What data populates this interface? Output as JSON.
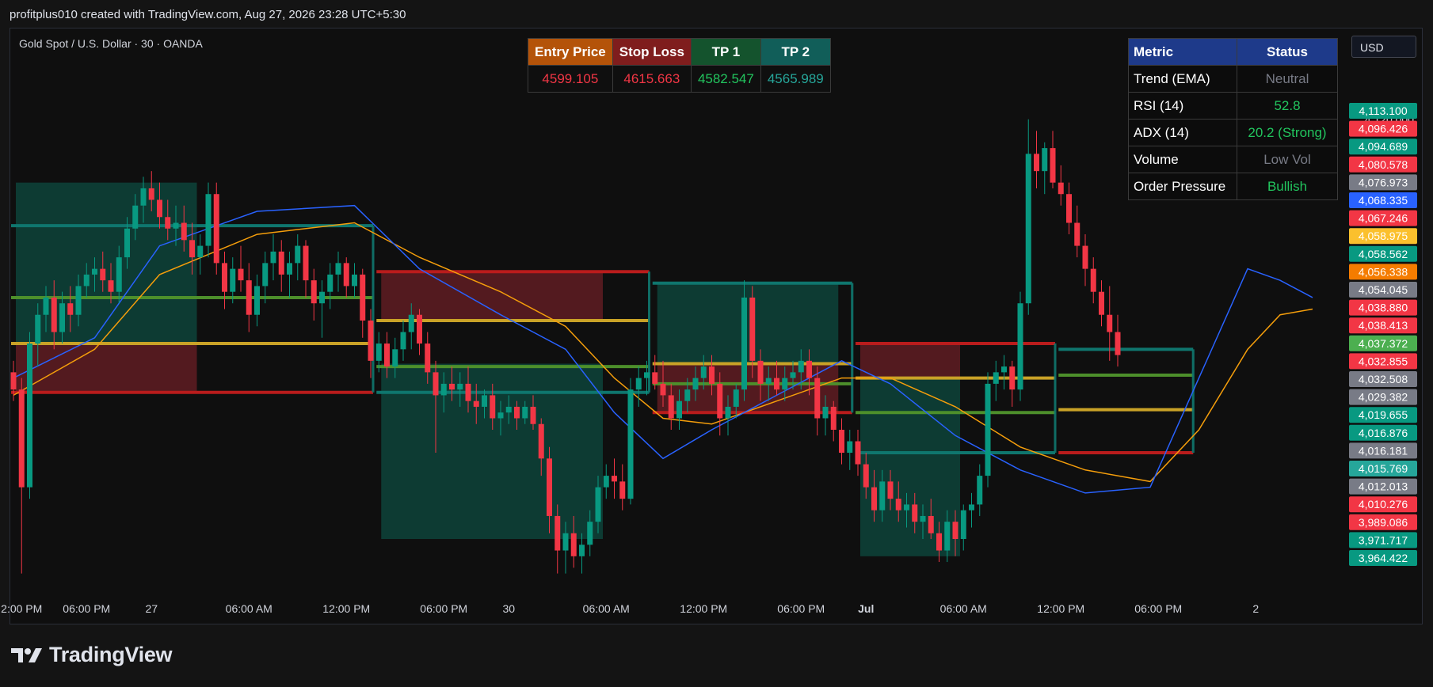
{
  "header": {
    "created_by": "profitplus010 created with TradingView.com, Aug 27, 2026 23:28 UTC+5:30"
  },
  "symbol": {
    "label": "Gold Spot / U.S. Dollar · 30 · OANDA"
  },
  "currency_button": {
    "label": "USD"
  },
  "brand": {
    "name": "TradingView"
  },
  "trade_table": {
    "headers": [
      {
        "label": "Entry Price",
        "bg": "#b45309"
      },
      {
        "label": "Stop Loss",
        "bg": "#7f1d1d"
      },
      {
        "label": "TP 1",
        "bg": "#14532d"
      },
      {
        "label": "TP 2",
        "bg": "#115e59"
      }
    ],
    "values": [
      {
        "value": "4599.105",
        "color": "#f23645"
      },
      {
        "value": "4615.663",
        "color": "#f23645"
      },
      {
        "value": "4582.547",
        "color": "#22c55e"
      },
      {
        "value": "4565.989",
        "color": "#26a69a"
      }
    ]
  },
  "status_table": {
    "headers": {
      "metric": "Metric",
      "status": "Status"
    },
    "rows": [
      {
        "metric": "Trend (EMA)",
        "status": "Neutral",
        "color": "#787b86"
      },
      {
        "metric": "RSI (14)",
        "status": "52.8",
        "color": "#22c55e"
      },
      {
        "metric": "ADX (14)",
        "status": "20.2 (Strong)",
        "color": "#22c55e"
      },
      {
        "metric": "Volume",
        "status": "Low Vol",
        "color": "#787b86"
      },
      {
        "metric": "Order Pressure",
        "status": "Bullish",
        "color": "#22c55e"
      }
    ]
  },
  "chart_data": {
    "type": "candlestick",
    "timeframe": "30",
    "title": "Gold Spot / U.S. Dollar · 30 · OANDA",
    "ylim": [
      3955,
      4145
    ],
    "x_ticks": [
      {
        "label": "2:00 PM",
        "bar": 1
      },
      {
        "label": "06:00 PM",
        "bar": 9
      },
      {
        "label": "27",
        "bar": 17
      },
      {
        "label": "06:00 AM",
        "bar": 29
      },
      {
        "label": "12:00 PM",
        "bar": 41
      },
      {
        "label": "06:00 PM",
        "bar": 53
      },
      {
        "label": "30",
        "bar": 61
      },
      {
        "label": "06:00 AM",
        "bar": 73
      },
      {
        "label": "12:00 PM",
        "bar": 85
      },
      {
        "label": "06:00 PM",
        "bar": 97
      },
      {
        "label": "Jul",
        "bar": 105,
        "bold": true
      },
      {
        "label": "06:00 AM",
        "bar": 117
      },
      {
        "label": "12:00 PM",
        "bar": 129
      },
      {
        "label": "06:00 PM",
        "bar": 141
      },
      {
        "label": "2",
        "bar": 153
      }
    ],
    "price_axis": {
      "tick_label": "4,120.000",
      "tick_value": 4120
    },
    "price_labels": [
      {
        "value": "4,113.100",
        "color": "#089981"
      },
      {
        "value": "4,096.426",
        "color": "#f23645"
      },
      {
        "value": "4,094.689",
        "color": "#089981"
      },
      {
        "value": "4,080.578",
        "color": "#f23645"
      },
      {
        "value": "4,076.973",
        "color": "#787b86"
      },
      {
        "value": "4,068.335",
        "color": "#2962ff"
      },
      {
        "value": "4,067.246",
        "color": "#f23645"
      },
      {
        "value": "4,058.975",
        "color": "#fbc02d"
      },
      {
        "value": "4,058.562",
        "color": "#089981"
      },
      {
        "value": "4,056.338",
        "color": "#f57c00"
      },
      {
        "value": "4,054.045",
        "color": "#787b86"
      },
      {
        "value": "4,038.880",
        "color": "#f23645"
      },
      {
        "value": "4,038.413",
        "color": "#f23645"
      },
      {
        "value": "4,037.372",
        "color": "#4caf50"
      },
      {
        "value": "4,032.855",
        "color": "#f23645"
      },
      {
        "value": "4,032.508",
        "color": "#787b86"
      },
      {
        "value": "4,029.382",
        "color": "#787b86"
      },
      {
        "value": "4,019.655",
        "color": "#089981"
      },
      {
        "value": "4,016.876",
        "color": "#089981"
      },
      {
        "value": "4,016.181",
        "color": "#787b86"
      },
      {
        "value": "4,015.769",
        "color": "#26a69a"
      },
      {
        "value": "4,012.013",
        "color": "#787b86"
      },
      {
        "value": "4,010.276",
        "color": "#f23645"
      },
      {
        "value": "3,989.086",
        "color": "#f23645"
      },
      {
        "value": "3,971.717",
        "color": "#089981"
      },
      {
        "value": "3,964.422",
        "color": "#089981"
      }
    ],
    "colors": {
      "up": "#089981",
      "down": "#f23645",
      "ema_fast": "#2962ff",
      "ema_slow": "#f59e0b",
      "entry": "#c9a227",
      "stop": "#b91c1c",
      "tp1": "#4d8f2b",
      "tp2": "#0f766e"
    },
    "candles": [
      [
        4032,
        4036,
        4022,
        4026
      ],
      [
        4026,
        4030,
        3962,
        3992
      ],
      [
        3992,
        4046,
        3988,
        4042
      ],
      [
        4042,
        4056,
        4034,
        4052
      ],
      [
        4052,
        4062,
        4046,
        4058
      ],
      [
        4058,
        4064,
        4040,
        4046
      ],
      [
        4046,
        4060,
        4042,
        4056
      ],
      [
        4056,
        4062,
        4046,
        4052
      ],
      [
        4052,
        4066,
        4048,
        4062
      ],
      [
        4062,
        4070,
        4058,
        4066
      ],
      [
        4066,
        4072,
        4060,
        4068
      ],
      [
        4068,
        4074,
        4060,
        4064
      ],
      [
        4064,
        4070,
        4056,
        4060
      ],
      [
        4060,
        4076,
        4056,
        4072
      ],
      [
        4072,
        4086,
        4068,
        4082
      ],
      [
        4082,
        4094,
        4078,
        4090
      ],
      [
        4090,
        4100,
        4084,
        4096
      ],
      [
        4096,
        4102,
        4088,
        4092
      ],
      [
        4092,
        4098,
        4082,
        4086
      ],
      [
        4086,
        4092,
        4078,
        4082
      ],
      [
        4082,
        4090,
        4076,
        4084
      ],
      [
        4084,
        4090,
        4074,
        4078
      ],
      [
        4078,
        4084,
        4066,
        4072
      ],
      [
        4072,
        4080,
        4066,
        4076
      ],
      [
        4076,
        4098,
        4072,
        4094
      ],
      [
        4094,
        4098,
        4066,
        4070
      ],
      [
        4070,
        4074,
        4054,
        4060
      ],
      [
        4060,
        4072,
        4056,
        4068
      ],
      [
        4068,
        4076,
        4060,
        4064
      ],
      [
        4064,
        4070,
        4046,
        4052
      ],
      [
        4052,
        4066,
        4048,
        4062
      ],
      [
        4062,
        4074,
        4056,
        4070
      ],
      [
        4070,
        4080,
        4064,
        4074
      ],
      [
        4074,
        4078,
        4060,
        4066
      ],
      [
        4066,
        4074,
        4058,
        4070
      ],
      [
        4070,
        4080,
        4064,
        4076
      ],
      [
        4076,
        4078,
        4058,
        4064
      ],
      [
        4064,
        4068,
        4050,
        4056
      ],
      [
        4056,
        4064,
        4044,
        4060
      ],
      [
        4060,
        4070,
        4054,
        4066
      ],
      [
        4066,
        4074,
        4060,
        4070
      ],
      [
        4070,
        4072,
        4058,
        4062
      ],
      [
        4062,
        4070,
        4058,
        4066
      ],
      [
        4066,
        4068,
        4044,
        4050
      ],
      [
        4050,
        4054,
        4030,
        4036
      ],
      [
        4036,
        4046,
        4032,
        4042
      ],
      [
        4042,
        4046,
        4030,
        4034
      ],
      [
        4034,
        4044,
        4030,
        4040
      ],
      [
        4040,
        4050,
        4036,
        4046
      ],
      [
        4046,
        4056,
        4040,
        4052
      ],
      [
        4052,
        4054,
        4038,
        4042
      ],
      [
        4042,
        4046,
        4028,
        4032
      ],
      [
        4032,
        4036,
        4004,
        4024
      ],
      [
        4024,
        4032,
        4018,
        4028
      ],
      [
        4028,
        4034,
        4022,
        4026
      ],
      [
        4026,
        4032,
        4020,
        4028
      ],
      [
        4028,
        4034,
        4018,
        4022
      ],
      [
        4022,
        4028,
        4014,
        4020
      ],
      [
        4020,
        4026,
        4016,
        4024
      ],
      [
        4024,
        4028,
        4012,
        4016
      ],
      [
        4016,
        4022,
        4010,
        4018
      ],
      [
        4018,
        4024,
        4014,
        4020
      ],
      [
        4020,
        4022,
        4012,
        4016
      ],
      [
        4016,
        4022,
        4014,
        4020
      ],
      [
        4020,
        4024,
        4012,
        4014
      ],
      [
        4014,
        4016,
        3996,
        4002
      ],
      [
        4002,
        4006,
        3976,
        3982
      ],
      [
        3982,
        3986,
        3962,
        3970
      ],
      [
        3970,
        3980,
        3962,
        3976
      ],
      [
        3976,
        3982,
        3964,
        3968
      ],
      [
        3968,
        3976,
        3962,
        3972
      ],
      [
        3972,
        3984,
        3968,
        3980
      ],
      [
        3980,
        3996,
        3976,
        3992
      ],
      [
        3992,
        4000,
        3988,
        3996
      ],
      [
        3996,
        4002,
        3988,
        3994
      ],
      [
        3994,
        4000,
        3984,
        3988
      ],
      [
        3988,
        4030,
        3986,
        4026
      ],
      [
        4026,
        4034,
        4020,
        4030
      ],
      [
        4030,
        4036,
        4024,
        4032
      ],
      [
        4032,
        4038,
        4026,
        4028
      ],
      [
        4028,
        4036,
        4020,
        4024
      ],
      [
        4024,
        4028,
        4012,
        4016
      ],
      [
        4016,
        4026,
        4012,
        4022
      ],
      [
        4022,
        4030,
        4018,
        4026
      ],
      [
        4026,
        4034,
        4022,
        4030
      ],
      [
        4030,
        4038,
        4026,
        4034
      ],
      [
        4034,
        4038,
        4024,
        4028
      ],
      [
        4028,
        4032,
        4010,
        4016
      ],
      [
        4016,
        4024,
        4010,
        4020
      ],
      [
        4020,
        4028,
        4016,
        4026
      ],
      [
        4026,
        4064,
        4022,
        4058
      ],
      [
        4058,
        4062,
        4030,
        4036
      ],
      [
        4036,
        4040,
        4022,
        4028
      ],
      [
        4028,
        4034,
        4022,
        4030
      ],
      [
        4030,
        4036,
        4024,
        4026
      ],
      [
        4026,
        4034,
        4022,
        4030
      ],
      [
        4030,
        4036,
        4026,
        4032
      ],
      [
        4032,
        4040,
        4026,
        4036
      ],
      [
        4036,
        4040,
        4024,
        4030
      ],
      [
        4030,
        4034,
        4010,
        4016
      ],
      [
        4016,
        4024,
        4010,
        4020
      ],
      [
        4020,
        4022,
        4008,
        4012
      ],
      [
        4012,
        4016,
        4000,
        4004
      ],
      [
        4004,
        4012,
        3998,
        4008
      ],
      [
        4008,
        4012,
        3996,
        4000
      ],
      [
        4000,
        4004,
        3988,
        3992
      ],
      [
        3992,
        3998,
        3980,
        3984
      ],
      [
        3984,
        3998,
        3980,
        3994
      ],
      [
        3994,
        3998,
        3984,
        3988
      ],
      [
        3988,
        3994,
        3980,
        3984
      ],
      [
        3984,
        3990,
        3978,
        3986
      ],
      [
        3986,
        3990,
        3976,
        3980
      ],
      [
        3980,
        3986,
        3974,
        3982
      ],
      [
        3982,
        3988,
        3974,
        3976
      ],
      [
        3976,
        3980,
        3966,
        3970
      ],
      [
        3970,
        3984,
        3966,
        3980
      ],
      [
        3980,
        3984,
        3968,
        3974
      ],
      [
        3974,
        3986,
        3970,
        3984
      ],
      [
        3984,
        3990,
        3978,
        3986
      ],
      [
        3986,
        4000,
        3982,
        3996
      ],
      [
        3996,
        4032,
        3992,
        4028
      ],
      [
        4028,
        4036,
        4022,
        4032
      ],
      [
        4032,
        4038,
        4026,
        4034
      ],
      [
        4034,
        4036,
        4020,
        4026
      ],
      [
        4026,
        4060,
        4022,
        4056
      ],
      [
        4056,
        4120,
        4052,
        4108
      ],
      [
        4108,
        4116,
        4096,
        4102
      ],
      [
        4102,
        4112,
        4094,
        4110
      ],
      [
        4110,
        4116,
        4096,
        4098
      ],
      [
        4098,
        4104,
        4090,
        4094
      ],
      [
        4094,
        4098,
        4080,
        4084
      ],
      [
        4084,
        4090,
        4072,
        4076
      ],
      [
        4076,
        4080,
        4062,
        4068
      ],
      [
        4068,
        4072,
        4056,
        4060
      ],
      [
        4060,
        4064,
        4048,
        4052
      ],
      [
        4052,
        4062,
        4036,
        4046
      ],
      [
        4046,
        4052,
        4034,
        4038
      ]
    ],
    "ema_fast": [
      [
        0,
        4030
      ],
      [
        10,
        4044
      ],
      [
        18,
        4076
      ],
      [
        30,
        4088
      ],
      [
        42,
        4090
      ],
      [
        50,
        4068
      ],
      [
        60,
        4052
      ],
      [
        68,
        4040
      ],
      [
        74,
        4018
      ],
      [
        80,
        4002
      ],
      [
        86,
        4012
      ],
      [
        94,
        4024
      ],
      [
        102,
        4036
      ],
      [
        108,
        4028
      ],
      [
        116,
        4010
      ],
      [
        124,
        3998
      ],
      [
        132,
        3990
      ],
      [
        140,
        3992
      ],
      [
        146,
        4030
      ],
      [
        152,
        4068
      ],
      [
        156,
        4064
      ],
      [
        160,
        4058
      ]
    ],
    "ema_slow": [
      [
        0,
        4024
      ],
      [
        10,
        4040
      ],
      [
        18,
        4066
      ],
      [
        30,
        4080
      ],
      [
        42,
        4084
      ],
      [
        50,
        4072
      ],
      [
        60,
        4060
      ],
      [
        68,
        4048
      ],
      [
        74,
        4030
      ],
      [
        80,
        4016
      ],
      [
        86,
        4014
      ],
      [
        94,
        4022
      ],
      [
        102,
        4030
      ],
      [
        108,
        4030
      ],
      [
        116,
        4020
      ],
      [
        124,
        4006
      ],
      [
        132,
        3998
      ],
      [
        140,
        3994
      ],
      [
        146,
        4012
      ],
      [
        152,
        4040
      ],
      [
        156,
        4052
      ],
      [
        160,
        4054
      ]
    ],
    "trade_setups": [
      {
        "start": 0,
        "end": 44,
        "entry": 4042,
        "stop": 4025,
        "tp1": 4058,
        "tp2": 4083,
        "shade_end": 22,
        "profit_from": 4042,
        "profit_to": 4098,
        "loss_from": 4042,
        "loss_to": 4025
      },
      {
        "start": 45,
        "end": 78,
        "entry": 4050,
        "stop": 4067,
        "tp1": 4034,
        "tp2": 4025,
        "shade_end": 72,
        "profit_from": 4035,
        "profit_to": 3974,
        "loss_from": 4050,
        "loss_to": 4067
      },
      {
        "start": 79,
        "end": 103,
        "entry": 4035,
        "stop": 4018,
        "tp1": 4028,
        "tp2": 4063,
        "shade_end": 101,
        "profit_from": 4035,
        "profit_to": 4063,
        "loss_from": 4035,
        "loss_to": 4018
      },
      {
        "start": 104,
        "end": 128,
        "entry": 4030,
        "stop": 4042,
        "tp1": 4018,
        "tp2": 4004,
        "shade_end": 116,
        "profit_from": 4030,
        "profit_to": 3968,
        "loss_from": 4030,
        "loss_to": 4042
      },
      {
        "start": 129,
        "end": 145,
        "entry": 4019,
        "stop": 4004,
        "tp1": 4031,
        "tp2": 4040,
        "shade_end": 128,
        "profit_from": 0,
        "profit_to": 0,
        "loss_from": 0,
        "loss_to": 0
      }
    ]
  }
}
